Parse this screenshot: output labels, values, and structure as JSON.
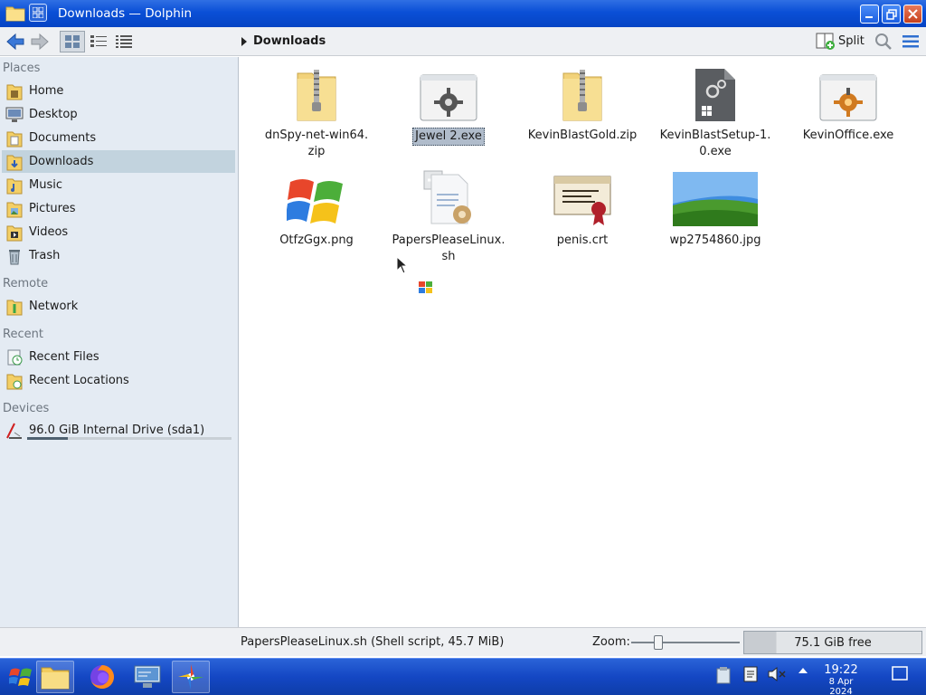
{
  "window": {
    "title": "Downloads — Dolphin"
  },
  "toolbar": {
    "breadcrumb": "Downloads",
    "split_label": "Split"
  },
  "sidebar": {
    "sections": {
      "places": "Places",
      "remote": "Remote",
      "recent": "Recent",
      "devices": "Devices"
    },
    "places": [
      {
        "label": "Home",
        "icon": "home-folder-icon"
      },
      {
        "label": "Desktop",
        "icon": "desktop-icon"
      },
      {
        "label": "Documents",
        "icon": "documents-folder-icon"
      },
      {
        "label": "Downloads",
        "icon": "downloads-folder-icon"
      },
      {
        "label": "Music",
        "icon": "music-folder-icon"
      },
      {
        "label": "Pictures",
        "icon": "pictures-folder-icon"
      },
      {
        "label": "Videos",
        "icon": "videos-folder-icon"
      },
      {
        "label": "Trash",
        "icon": "trash-icon"
      }
    ],
    "remote": [
      {
        "label": "Network",
        "icon": "network-folder-icon"
      }
    ],
    "recent": [
      {
        "label": "Recent Files",
        "icon": "recent-files-icon"
      },
      {
        "label": "Recent Locations",
        "icon": "recent-locations-icon"
      }
    ],
    "devices": [
      {
        "label": "96.0 GiB Internal Drive (sda1)",
        "icon": "drive-icon",
        "usage": 0.2
      }
    ],
    "active": "Downloads"
  },
  "files": [
    {
      "name": "dnSpy-net-win64.\nzip",
      "icon": "zip-archive-icon"
    },
    {
      "name": "Jewel 2.exe",
      "icon": "executable-icon",
      "selected": true
    },
    {
      "name": "KevinBlastGold.zip",
      "icon": "zip-archive-icon"
    },
    {
      "name": "KevinBlastSetup-1.\n0.exe",
      "icon": "exe-document-icon"
    },
    {
      "name": "KevinOffice.exe",
      "icon": "executable-icon"
    },
    {
      "name": "OtfzGgx.png",
      "icon": "windows-logo-image-icon"
    },
    {
      "name": "PapersPleaseLinux.\nsh",
      "icon": "shell-script-icon"
    },
    {
      "name": "penis.crt",
      "icon": "certificate-icon"
    },
    {
      "name": "wp2754860.jpg",
      "icon": "wallpaper-image-icon"
    }
  ],
  "status": {
    "text": "PapersPleaseLinux.sh (Shell script, 45.7 MiB)",
    "zoom_label": "Zoom:",
    "free_space": "75.1 GiB free",
    "zoom_level": 0.25
  },
  "taskbar": {
    "time": "19:22",
    "date": "8 Apr 2024"
  },
  "colors": {
    "titlebar": "#0a4fd6",
    "taskbar": "#1447c4",
    "sidebar": "#e4ebf3",
    "selection": "#c2d3de"
  }
}
